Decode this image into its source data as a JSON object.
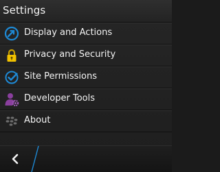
{
  "header": {
    "title": "Settings"
  },
  "menu": {
    "items": [
      {
        "label": "Display and Actions",
        "icon": "display-actions-icon"
      },
      {
        "label": "Privacy and Security",
        "icon": "padlock-icon"
      },
      {
        "label": "Site Permissions",
        "icon": "checkmark-circle-icon"
      },
      {
        "label": "Developer Tools",
        "icon": "developer-gear-person-icon"
      },
      {
        "label": "About",
        "icon": "blackberry-logo-icon"
      }
    ]
  },
  "footer": {
    "back_icon": "chevron-left-icon"
  },
  "colors": {
    "accent_blue": "#1e8ad6",
    "lock_yellow": "#f2c200",
    "developer_purple": "#8a3f9e",
    "background": "#1e1e1e",
    "text": "#f4f4f4"
  }
}
